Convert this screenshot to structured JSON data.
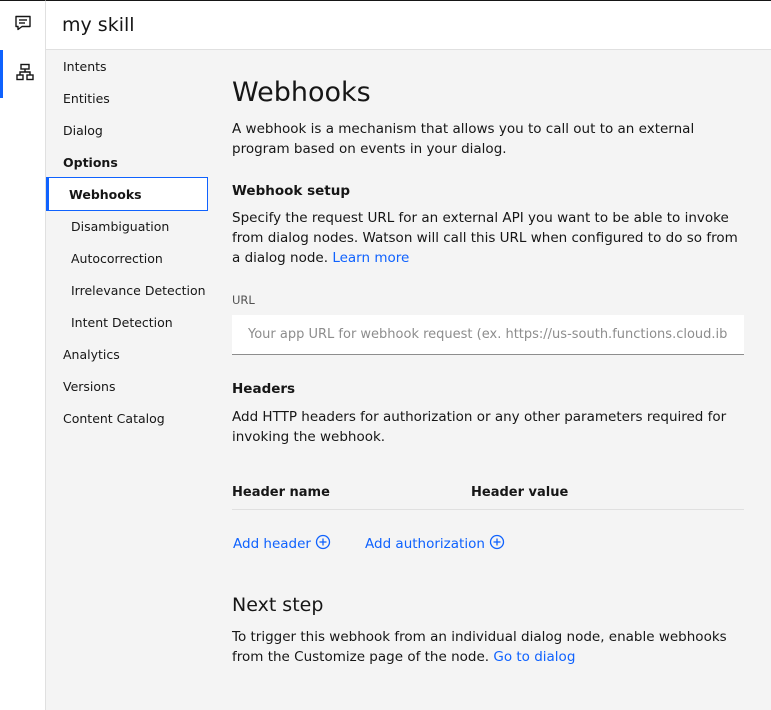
{
  "app": {
    "skill_title": "my skill"
  },
  "rail": {
    "items": [
      {
        "icon": "chat-icon"
      },
      {
        "icon": "tree-diagram-icon",
        "active": true
      }
    ]
  },
  "nav": {
    "items": {
      "intents": "Intents",
      "entities": "Entities",
      "dialog": "Dialog",
      "options": "Options",
      "webhooks": "Webhooks",
      "disambiguation": "Disambiguation",
      "autocorrection": "Autocorrection",
      "irrelevance": "Irrelevance Detection",
      "intent_detection": "Intent Detection",
      "analytics": "Analytics",
      "versions": "Versions",
      "content_catalog": "Content Catalog"
    },
    "selected": "Webhooks"
  },
  "main": {
    "title": "Webhooks",
    "intro": "A webhook is a mechanism that allows you to call out to an external program based on events in your dialog.",
    "setup_heading": "Webhook setup",
    "setup_text": "Specify the request URL for an external API you want to be able to invoke from dialog nodes. Watson will call this URL when configured to do so from a dialog node.",
    "learn_more": "Learn more",
    "url_label": "URL",
    "url_placeholder": "Your app URL for webhook request (ex. https://us-south.functions.cloud.ibm.com/...)",
    "url_value": "",
    "headers_heading": "Headers",
    "headers_text": "Add HTTP headers for authorization or any other parameters required for invoking the webhook.",
    "col_header_name": "Header name",
    "col_header_value": "Header value",
    "add_header": "Add header",
    "add_authorization": "Add authorization",
    "next_step_heading": "Next step",
    "next_step_text": "To trigger this webhook from an individual dialog node, enable webhooks from the Customize page of the node.",
    "go_to_dialog": "Go to dialog"
  },
  "colors": {
    "accent": "#0f62fe",
    "background": "#f4f4f4",
    "text": "#161616"
  }
}
